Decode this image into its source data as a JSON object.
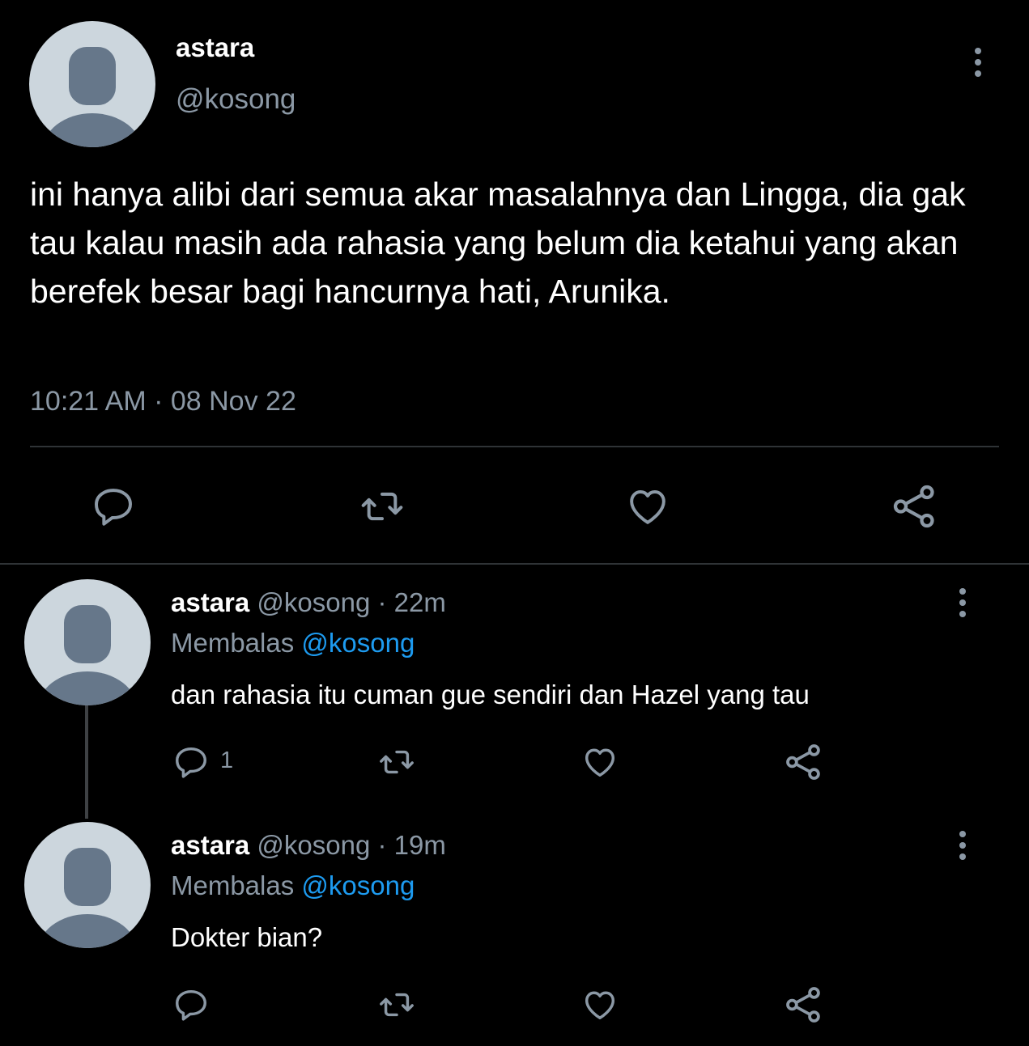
{
  "colors": {
    "background": "#000000",
    "text_primary": "#ffffff",
    "text_secondary": "#8b98a5",
    "mention": "#1d9bf0",
    "divider": "#2f3336",
    "avatar_bg": "#ccd6dd",
    "avatar_fg": "#66778a"
  },
  "tweet": {
    "display_name": "astara",
    "handle": "@kosong",
    "body": "ini hanya alibi dari semua akar masalahnya dan Lingga, dia gak tau kalau masih ada rahasia yang belum dia ketahui yang akan berefek besar bagi hancurnya hati, Arunika.",
    "timestamp": "10:21 AM · 08 Nov 22",
    "actions": [
      "reply-icon",
      "retweet-icon",
      "like-icon",
      "share-icon"
    ]
  },
  "replies": [
    {
      "display_name": "astara",
      "handle_time": " @kosong · 22m",
      "replying_label": "Membalas ",
      "replying_to": "@kosong",
      "text": "dan rahasia itu cuman gue sendiri dan Hazel yang tau",
      "reply_count": "1"
    },
    {
      "display_name": "astara",
      "handle_time": " @kosong · 19m",
      "replying_label": "Membalas ",
      "replying_to": "@kosong",
      "text": "Dokter bian?",
      "reply_count": ""
    }
  ]
}
